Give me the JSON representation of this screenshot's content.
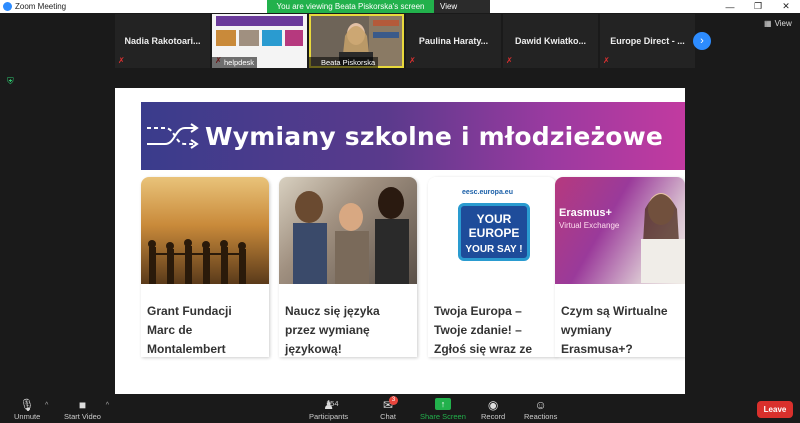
{
  "window": {
    "title": "Zoom Meeting"
  },
  "banner": {
    "message": "You are viewing Beata Piskorska's screen",
    "options_label": "View Options"
  },
  "view_button": {
    "label": "View"
  },
  "participants": [
    {
      "name": "Nadia  Rakotoari...",
      "muted": true
    },
    {
      "name": "helpdesk",
      "muted": true,
      "video": true
    },
    {
      "name": "Beata Piskorska",
      "video": true,
      "active": true
    },
    {
      "name": "Paulina  Haraty...",
      "muted": true
    },
    {
      "name": "Dawid  Kwiatko...",
      "muted": true
    },
    {
      "name": "Europe Direct - ...",
      "muted": true
    }
  ],
  "shared": {
    "hero_title": "Wymiany szkolne i młodzieżowe",
    "cards": [
      {
        "title": "Grant Fundacji Marc de Montalembert"
      },
      {
        "title": "Naucz się języka przez wymianę językową!"
      },
      {
        "title": "Twoja Europa – Twoje zdanie! – Zgłoś się wraz ze swoją szkołą!",
        "img_caption_top": "eesc.europa.eu",
        "img_line1": "YOUR EUROPE",
        "img_line2": "YOUR SAY !"
      },
      {
        "title": "Czym są Wirtualne wymiany Erasmusa+?",
        "img_brand": "Erasmus+",
        "img_sub": "Virtual Exchange"
      }
    ]
  },
  "toolbar": {
    "unmute": "Unmute",
    "start_video": "Start Video",
    "participants": "Participants",
    "participants_count": "154",
    "chat": "Chat",
    "chat_badge": "3",
    "share_screen": "Share Screen",
    "record": "Record",
    "reactions": "Reactions",
    "leave": "Leave"
  },
  "colors": {
    "accent": "#2d8cff",
    "share_green": "#22b14c",
    "leave_red": "#d9302c"
  }
}
